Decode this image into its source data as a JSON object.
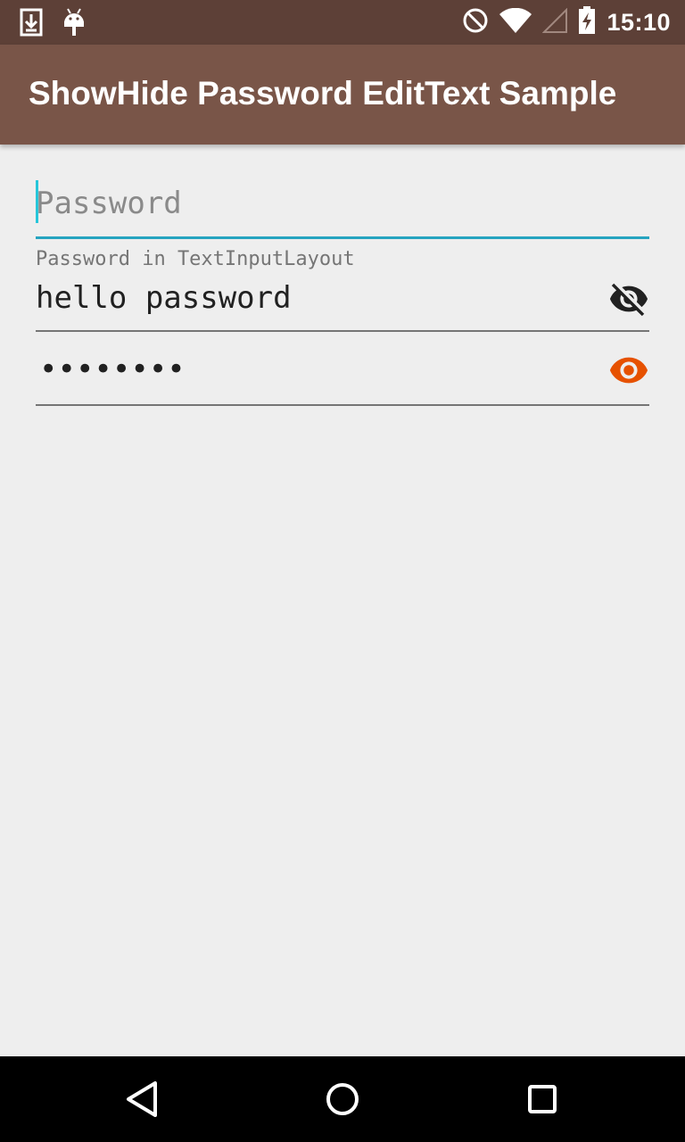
{
  "status_bar": {
    "time": "15:10",
    "left_icons": [
      "download-icon",
      "android-icon"
    ],
    "right_icons": [
      "do-not-disturb-icon",
      "wifi-icon",
      "cell-signal-icon",
      "battery-charging-icon"
    ]
  },
  "app_bar": {
    "title": "ShowHide Password EditText Sample",
    "color": "#795548"
  },
  "fields": {
    "password_plain": {
      "placeholder": "Password",
      "focused": true,
      "accent": "#26c6da"
    },
    "password_til": {
      "hint": "Password in TextInputLayout",
      "value": "hello password",
      "toggle_icon": "visibility-off-icon"
    },
    "password_masked": {
      "masked_value": "••••••••",
      "toggle_icon": "visibility-icon",
      "toggle_color": "#e65100"
    }
  },
  "nav_bar": {
    "buttons": [
      "back-icon",
      "home-icon",
      "recents-icon"
    ]
  }
}
